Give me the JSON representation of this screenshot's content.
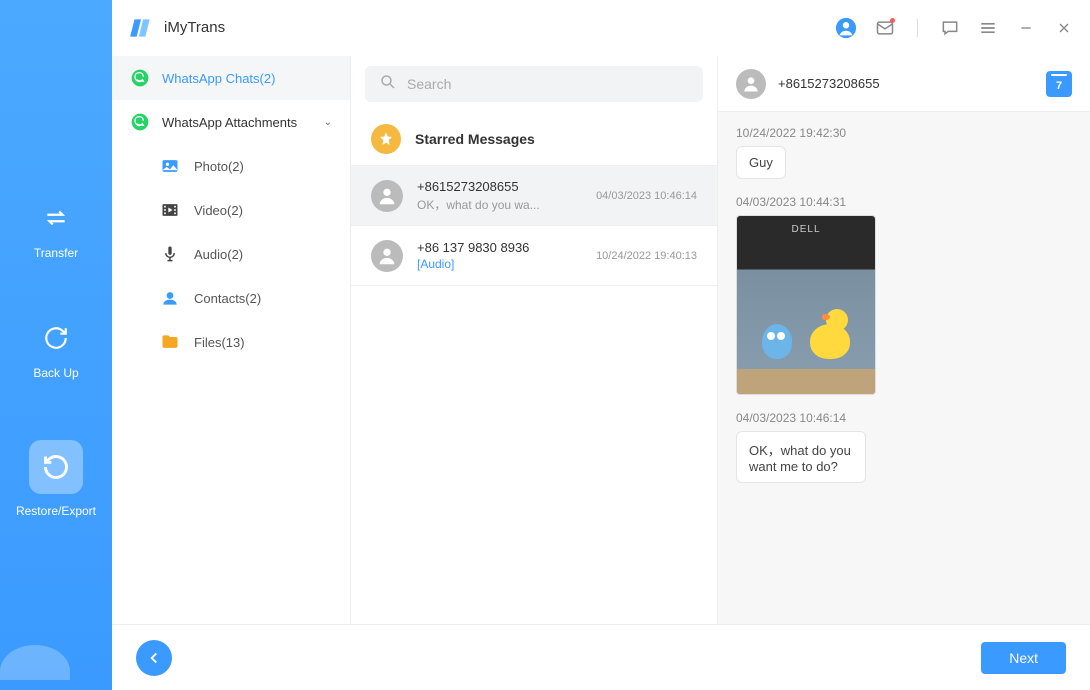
{
  "app": {
    "name": "iMyTrans"
  },
  "leftNav": {
    "transfer": "Transfer",
    "backup": "Back Up",
    "restore": "Restore/Export"
  },
  "categories": {
    "chats": "WhatsApp Chats(2)",
    "attachments": "WhatsApp Attachments",
    "photo": "Photo(2)",
    "video": "Video(2)",
    "audio": "Audio(2)",
    "contacts": "Contacts(2)",
    "files": "Files(13)"
  },
  "search": {
    "placeholder": "Search"
  },
  "starred": {
    "label": "Starred Messages"
  },
  "chats": [
    {
      "name": "+8615273208655",
      "preview": "OK，what do you wa...",
      "time": "04/03/2023 10:46:14"
    },
    {
      "name": "+86 137 9830 8936",
      "preview": "[Audio]",
      "time": "10/24/2022 19:40:13"
    }
  ],
  "conversation": {
    "title": "+8615273208655",
    "calendarDay": "7",
    "messages": [
      {
        "ts": "10/24/2022 19:42:30",
        "text": "Guy",
        "type": "text"
      },
      {
        "ts": "04/03/2023 10:44:31",
        "type": "image"
      },
      {
        "ts": "04/03/2023 10:46:14",
        "text": "OK，what do you want me to do?",
        "type": "text"
      }
    ]
  },
  "footer": {
    "next": "Next"
  }
}
